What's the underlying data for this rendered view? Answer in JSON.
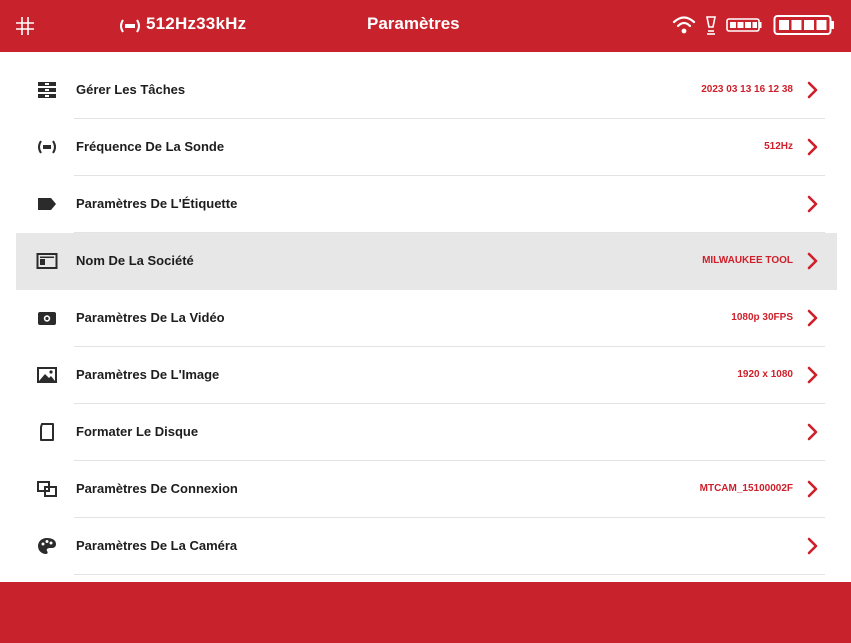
{
  "header": {
    "frequency": "512Hz33kHz",
    "title": "Paramètres",
    "icons": [
      "grid-icon",
      "sonde-icon",
      "wifi-icon",
      "lamp-icon",
      "camera-battery-icon",
      "battery-icon"
    ],
    "battery_level": 1.0
  },
  "colors": {
    "brand_red": "#c8232c",
    "value_red": "#cf1f2a",
    "label_dark": "#1d1d1d",
    "selected_bg": "#e7e7e7"
  },
  "settings": {
    "items": [
      {
        "label": "Gérer Les Tâches",
        "value": "2023 03 13 16 12 38",
        "icon": "tasks-icon"
      },
      {
        "label": "Fréquence De La Sonde",
        "value": "512Hz",
        "icon": "sonde-frequency-icon"
      },
      {
        "label": "Paramètres De L'Étiquette",
        "value": "",
        "icon": "label-tag-icon"
      },
      {
        "label": "Nom De La Société",
        "value": "MILWAUKEE TOOL",
        "icon": "company-card-icon"
      },
      {
        "label": "Paramètres De La Vidéo",
        "value": "1080p 30FPS",
        "icon": "video-camera-icon"
      },
      {
        "label": "Paramètres De L'Image",
        "value": "1920 x 1080",
        "icon": "image-icon"
      },
      {
        "label": "Formater Le Disque",
        "value": "",
        "icon": "sd-card-icon"
      },
      {
        "label": "Paramètres De Connexion",
        "value": "MTCAM_15100002F",
        "icon": "connection-icon"
      },
      {
        "label": "Paramètres De La Caméra",
        "value": "",
        "icon": "palette-icon"
      }
    ]
  }
}
